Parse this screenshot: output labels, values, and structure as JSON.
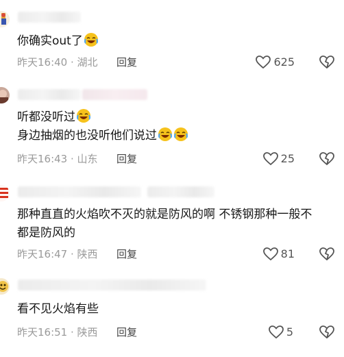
{
  "comments": [
    {
      "text": "你确实out了",
      "emoji_count": 1,
      "time": "昨天16:40",
      "location": "湖北",
      "reply_label": "回复",
      "likes": "625"
    },
    {
      "text_lines": [
        "听都没听过",
        "身边抽烟的也没听他们说过"
      ],
      "line1_emoji_count": 1,
      "line2_emoji_count": 2,
      "time": "昨天16:43",
      "location": "山东",
      "reply_label": "回复",
      "likes": "25"
    },
    {
      "text": "那种直直的火焰吹不灭的就是防风的啊 不锈钢那种一般不都是防风的",
      "time": "昨天16:47",
      "location": "陕西",
      "reply_label": "回复",
      "likes": "81"
    },
    {
      "text": "看不见火焰有些",
      "time": "昨天16:51",
      "location": "陕西",
      "reply_label": "回复",
      "likes": "5"
    }
  ],
  "icons": {
    "like": "heart-outline-icon",
    "dislike": "broken-heart-outline-icon",
    "emoji": "laughing-crying-emoji"
  },
  "colors": {
    "text": "#161616",
    "meta": "#9a9a9a",
    "reply": "#444444",
    "emoji_face": "#f6c21c"
  }
}
